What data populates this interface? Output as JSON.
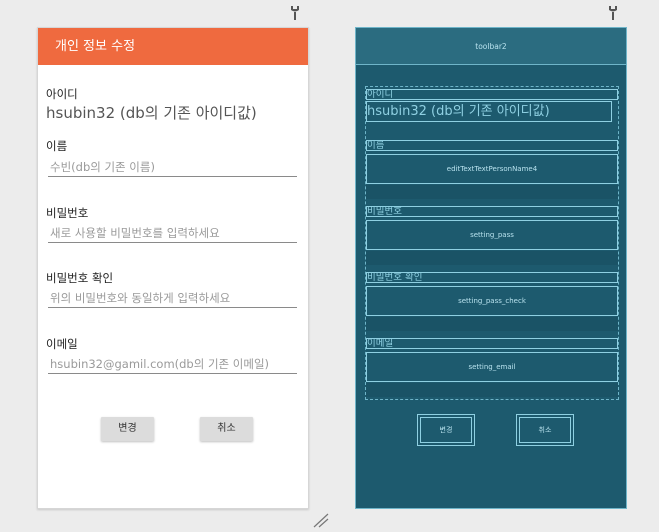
{
  "design": {
    "toolbar_title": "개인 정보 수정",
    "id_label": "아이디",
    "id_value": "hsubin32 (db의 기존 아이디값)",
    "name_label": "이름",
    "name_value": "수빈(db의 기존 이름)",
    "password_label": "비밀번호",
    "password_placeholder": "새로 사용할 비밀번호를 입력하세요",
    "password_confirm_label": "비밀번호 확인",
    "password_confirm_placeholder": "위의 비밀번호와 동일하게 입력하세요",
    "email_label": "이메일",
    "email_value": "hsubin32@gamil.com(db의 기존 이메일)",
    "change_button": "변경",
    "cancel_button": "취소"
  },
  "blueprint": {
    "toolbar_id": "toolbar2",
    "id_label": "아이디",
    "id_value": "hsubin32 (db의 기존 아이디값)",
    "name_label": "이름",
    "name_field_id": "editTextTextPersonName4",
    "password_label": "비밀번호",
    "password_field_id": "setting_pass",
    "password_confirm_label": "비밀번호 확인",
    "password_confirm_field_id": "setting_pass_check",
    "email_label": "이메일",
    "email_field_id": "setting_email",
    "change_button": "변경",
    "cancel_button": "취소"
  },
  "colors": {
    "toolbar": "#ef6a3f",
    "blueprint_bg": "#1d5a6e",
    "blueprint_line": "#8fd0e2"
  },
  "icons": [
    "wrench-icon",
    "resize-handle-icon"
  ]
}
